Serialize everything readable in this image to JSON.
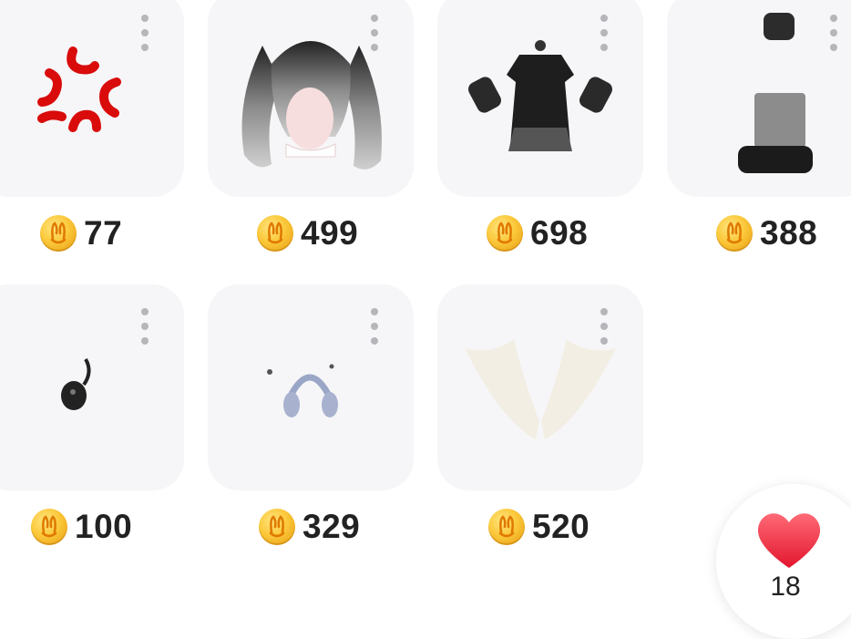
{
  "items": [
    {
      "name": "anger-emote",
      "price": "77"
    },
    {
      "name": "bunny-ear-hair",
      "price": "499"
    },
    {
      "name": "gothic-dress-outfit",
      "price": "698"
    },
    {
      "name": "platform-boots-outfit",
      "price": "388"
    },
    {
      "name": "black-plush-accessory",
      "price": "100"
    },
    {
      "name": "headphones-accessory",
      "price": "329"
    },
    {
      "name": "white-wings",
      "price": "520"
    }
  ],
  "like": {
    "count": "18",
    "icon": "heart-icon",
    "color": "#f23a4a"
  },
  "coin": {
    "icon": "bunny-coin-icon",
    "color": "#fbc83a"
  }
}
